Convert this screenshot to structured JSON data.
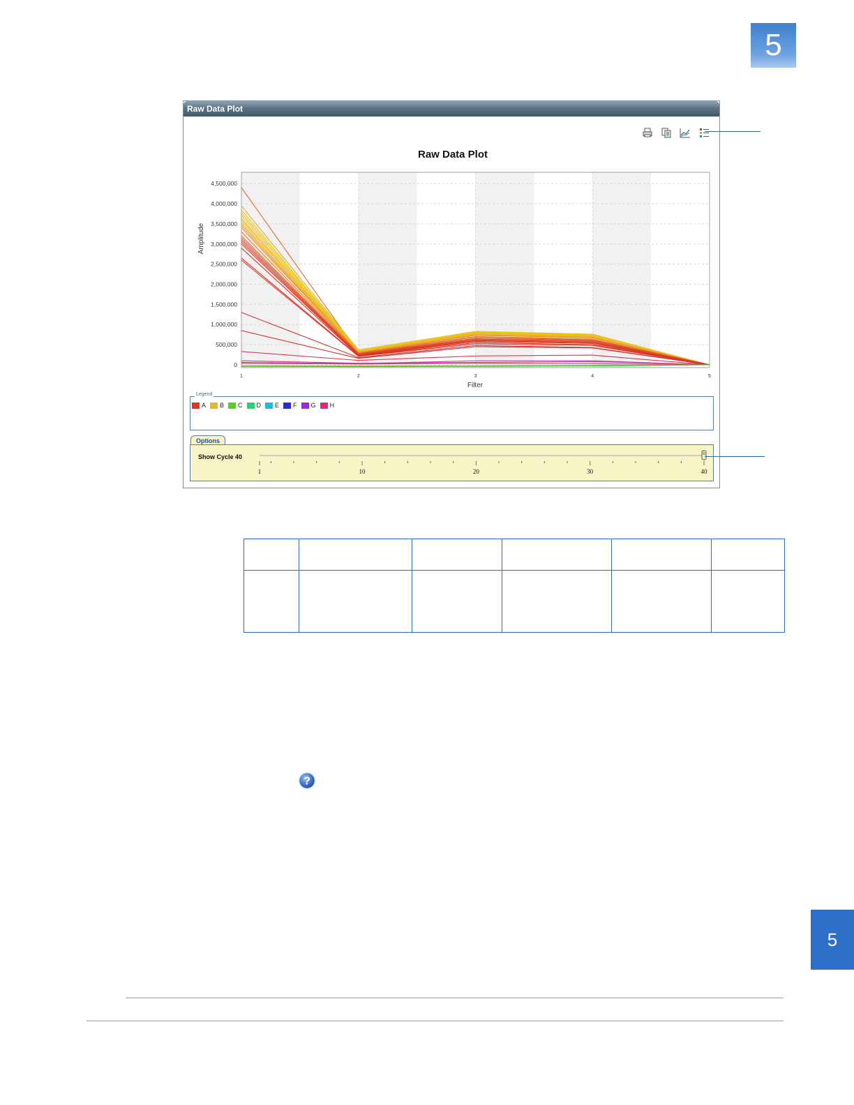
{
  "page": {
    "chapter_number": "5",
    "side_tab_number": "5"
  },
  "window": {
    "title": "Raw Data Plot",
    "toolbar": [
      {
        "name": "print-icon",
        "tooltip": ""
      },
      {
        "name": "copy-icon",
        "tooltip": ""
      },
      {
        "name": "plot-settings-icon",
        "tooltip": ""
      },
      {
        "name": "legend-toggle-icon",
        "tooltip": ""
      }
    ]
  },
  "chart_data": {
    "type": "line",
    "title": "Raw Data Plot",
    "xlabel": "Filter",
    "ylabel": "Amplitude",
    "x": [
      1,
      2,
      3,
      4,
      5
    ],
    "x_tick_labels": [
      "1",
      "2",
      "3",
      "4",
      "5"
    ],
    "y_tick_labels": [
      "0",
      "500,000",
      "1,000,000",
      "1,500,000",
      "2,000,000",
      "2,500,000",
      "3,000,000",
      "3,500,000",
      "4,000,000",
      "4,500,000"
    ],
    "y_ticks": [
      0,
      500000,
      1000000,
      1500000,
      2000000,
      2500000,
      3000000,
      3500000,
      4000000,
      4500000
    ],
    "xlim": [
      1,
      5
    ],
    "ylim": [
      -70000,
      4780000
    ],
    "grid": true,
    "series": [
      {
        "color": "#e06a2e",
        "values": [
          4400000,
          300000,
          780000,
          700000,
          0
        ]
      },
      {
        "color": "#d9b22a",
        "values": [
          3950000,
          370000,
          830000,
          760000,
          0
        ]
      },
      {
        "color": "#e6c41f",
        "values": [
          3850000,
          350000,
          810000,
          740000,
          0
        ]
      },
      {
        "color": "#f0d000",
        "values": [
          3780000,
          360000,
          820000,
          750000,
          0
        ]
      },
      {
        "color": "#e8c21a",
        "values": [
          3720000,
          345000,
          800000,
          735000,
          0
        ]
      },
      {
        "color": "#efc020",
        "values": [
          3650000,
          340000,
          790000,
          720000,
          0
        ]
      },
      {
        "color": "#e7b62a",
        "values": [
          3600000,
          330000,
          780000,
          710000,
          0
        ]
      },
      {
        "color": "#f2cc30",
        "values": [
          3550000,
          325000,
          760000,
          700000,
          0
        ]
      },
      {
        "color": "#e6a52c",
        "values": [
          3500000,
          320000,
          750000,
          690000,
          0
        ]
      },
      {
        "color": "#eaa526",
        "values": [
          3450000,
          310000,
          740000,
          680000,
          0
        ]
      },
      {
        "color": "#e6952a",
        "values": [
          3400000,
          305000,
          730000,
          670000,
          0
        ]
      },
      {
        "color": "#e07a2a",
        "values": [
          3300000,
          290000,
          700000,
          640000,
          0
        ]
      },
      {
        "color": "#e8672c",
        "values": [
          3200000,
          280000,
          690000,
          620000,
          0
        ]
      },
      {
        "color": "#e4522a",
        "values": [
          3150000,
          270000,
          660000,
          610000,
          0
        ]
      },
      {
        "color": "#e04a2a",
        "values": [
          3100000,
          260000,
          640000,
          590000,
          0
        ]
      },
      {
        "color": "#dd4428",
        "values": [
          3050000,
          250000,
          620000,
          570000,
          0
        ]
      },
      {
        "color": "#d83c26",
        "values": [
          3000000,
          240000,
          600000,
          550000,
          0
        ]
      },
      {
        "color": "#d83424",
        "values": [
          2900000,
          230000,
          580000,
          530000,
          0
        ]
      },
      {
        "color": "#d42f22",
        "values": [
          2650000,
          220000,
          550000,
          500000,
          0
        ]
      },
      {
        "color": "#e03a2a",
        "values": [
          2600000,
          210000,
          520000,
          480000,
          0
        ]
      },
      {
        "color": "#cc3a36",
        "values": [
          1300000,
          180000,
          480000,
          430000,
          0
        ]
      },
      {
        "color": "#d82c2c",
        "values": [
          850000,
          160000,
          450000,
          420000,
          0
        ]
      },
      {
        "color": "#e0304a",
        "values": [
          330000,
          110000,
          220000,
          240000,
          0
        ]
      },
      {
        "color": "#c83c9a",
        "values": [
          100000,
          40000,
          60000,
          80000,
          0
        ]
      },
      {
        "color": "#cc3aa8",
        "values": [
          60000,
          30000,
          100000,
          100000,
          0
        ]
      },
      {
        "color": "#e8305c",
        "values": [
          40000,
          20000,
          40000,
          30000,
          0
        ]
      },
      {
        "color": "#8ac23a",
        "values": [
          -20000,
          -25000,
          -20000,
          -10000,
          0
        ]
      },
      {
        "color": "#32c83a",
        "values": [
          -40000,
          -45000,
          -40000,
          -30000,
          0
        ]
      }
    ]
  },
  "legend": {
    "title": "Legend",
    "items": [
      {
        "label": "A",
        "color": "#e8321e"
      },
      {
        "label": "B",
        "color": "#e6b62a"
      },
      {
        "label": "C",
        "color": "#55d020"
      },
      {
        "label": "D",
        "color": "#28d070"
      },
      {
        "label": "E",
        "color": "#22b8e0"
      },
      {
        "label": "F",
        "color": "#2a2ad8"
      },
      {
        "label": "G",
        "color": "#9a2ad8"
      },
      {
        "label": "H",
        "color": "#e0287a"
      }
    ]
  },
  "options": {
    "tab_label": "Options",
    "show_cycle_label": "Show Cycle 40",
    "slider": {
      "min": 1,
      "max": 40,
      "value": 40
    },
    "scale_labels": [
      {
        "value": 1,
        "text": "1"
      },
      {
        "value": 10,
        "text": "10"
      },
      {
        "value": 20,
        "text": "20"
      },
      {
        "value": 30,
        "text": "30"
      },
      {
        "value": 40,
        "text": "40"
      }
    ]
  },
  "table": {
    "rows": [
      [
        "",
        "",
        "",
        "",
        "",
        ""
      ],
      [
        "",
        "",
        "",
        "",
        "",
        ""
      ]
    ]
  }
}
